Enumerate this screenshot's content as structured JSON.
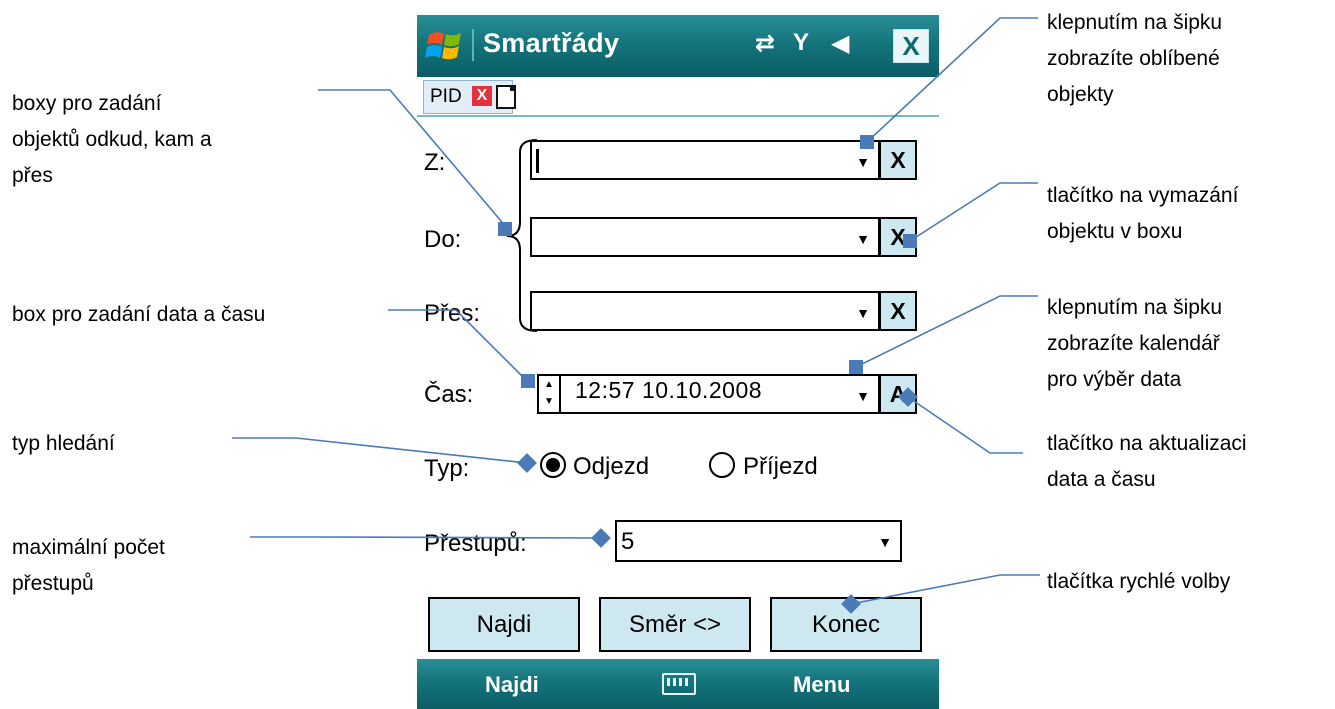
{
  "app": {
    "title": "Smartřády",
    "status_icons": [
      "connectivity-icon",
      "signal-off-icon",
      "speaker-icon"
    ],
    "close_label": "X"
  },
  "tab": {
    "label": "PID",
    "close_label": "X"
  },
  "form": {
    "from_label": "Z:",
    "from_value": "",
    "to_label": "Do:",
    "to_value": "",
    "via_label": "Přes:",
    "via_value": "",
    "clear_label": "X",
    "time_label": "Čas:",
    "time_value": "12:57  10.10.2008",
    "update_label": "A",
    "type_label": "Typ:",
    "type_options": [
      "Odjezd",
      "Příjezd"
    ],
    "type_selected": "Odjezd",
    "transfers_label": "Přestupů:",
    "transfers_value": "5"
  },
  "quick_buttons": [
    "Najdi",
    "Směr <>",
    "Konec"
  ],
  "softkeys": {
    "left": "Najdi",
    "center_icon": "keyboard-icon",
    "right": "Menu"
  },
  "annotations": {
    "boxes": [
      "boxy pro zadání",
      "objektů odkud, kam a",
      "přes"
    ],
    "datebox": "box pro zadání data a času",
    "search_type": "typ hledání",
    "max_transfers": [
      "maximální počet",
      "přestupů"
    ],
    "favorites": [
      "klepnutím na šipku",
      "zobrazíte oblíbené",
      "objekty"
    ],
    "clear_button": [
      "tlačítko na vymazání",
      "objektu v boxu"
    ],
    "calendar": [
      "klepnutím na šipku",
      "zobrazíte kalendář",
      "pro výběr data"
    ],
    "update_button": [
      "tlačítko na aktualizaci",
      "data a času"
    ],
    "quick_buttons": "tlačítka rychlé volby"
  },
  "colors": {
    "titlebar": "#14747c",
    "button_fill": "#cde8f0",
    "callout_line": "#4a7ab8",
    "callout_marker": "#4a7ab8"
  }
}
